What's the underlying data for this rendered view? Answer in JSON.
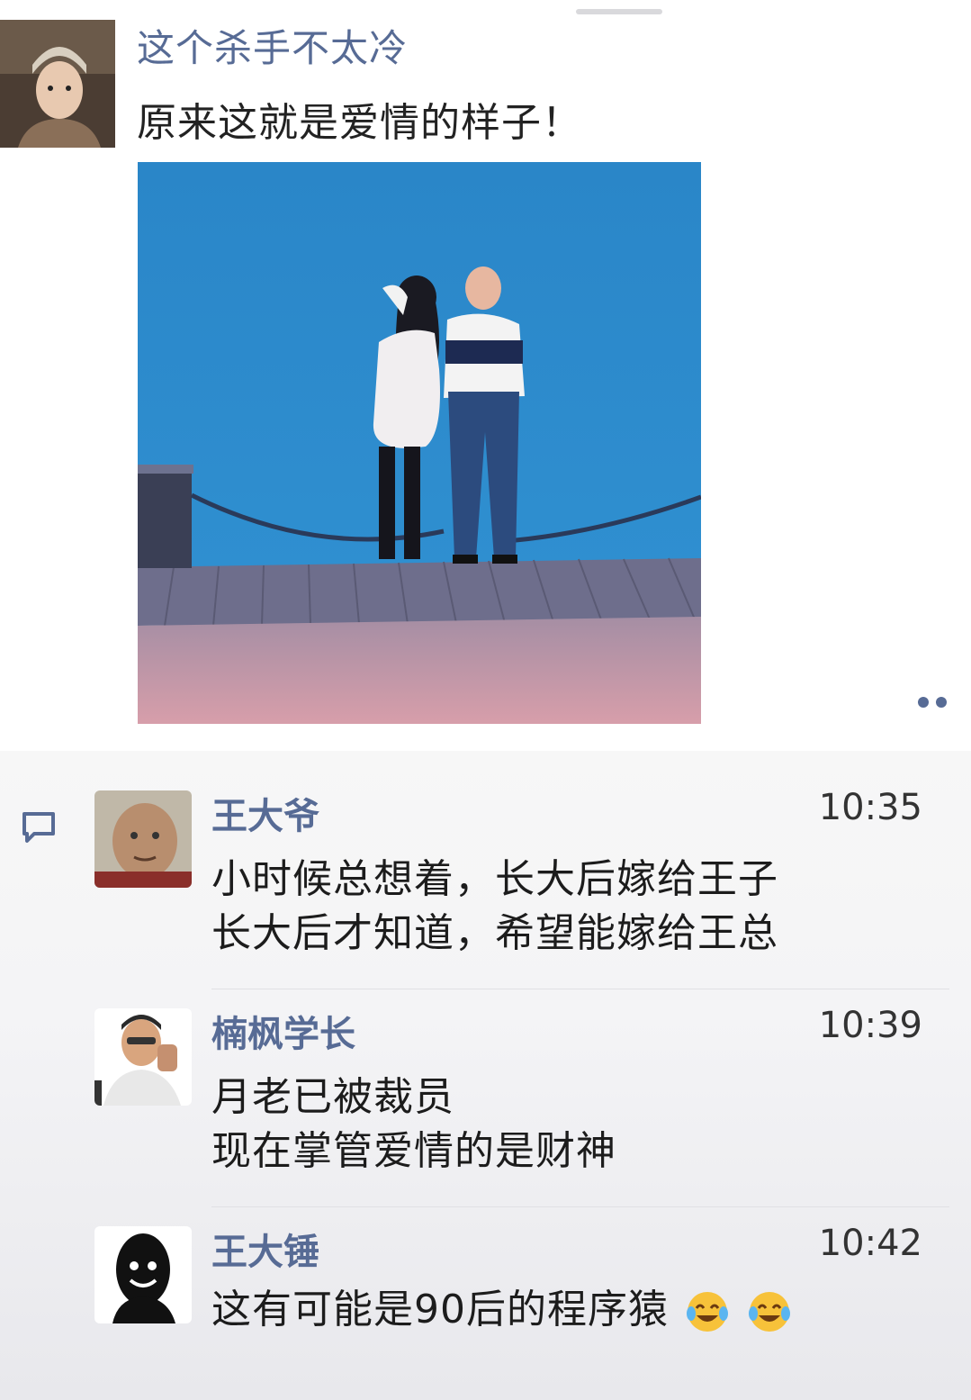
{
  "post": {
    "author": "这个杀手不太冷",
    "text": "原来这就是爱情的样子！",
    "image_description": "couple-by-sea-illustration",
    "more_icon": "more-dots-icon"
  },
  "comments_section": {
    "comment_icon": "comment-bubble-icon",
    "items": [
      {
        "name": "王大爷",
        "time": "10:35",
        "lines": [
          "小时候总想着，长大后嫁给王子",
          "长大后才知道，希望能嫁给王总"
        ]
      },
      {
        "name": "楠枫学长",
        "time": "10:39",
        "lines": [
          "月老已被裁员",
          "现在掌管爱情的是财神"
        ]
      },
      {
        "name": "王大锤",
        "time": "10:42",
        "lines": [
          "这有可能是90后的程序猿"
        ],
        "emojis": [
          "crying-laughing-emoji",
          "crying-laughing-emoji"
        ]
      }
    ]
  },
  "colors": {
    "link_blue": "#576b95",
    "sea_blue": "#2a86c8"
  }
}
